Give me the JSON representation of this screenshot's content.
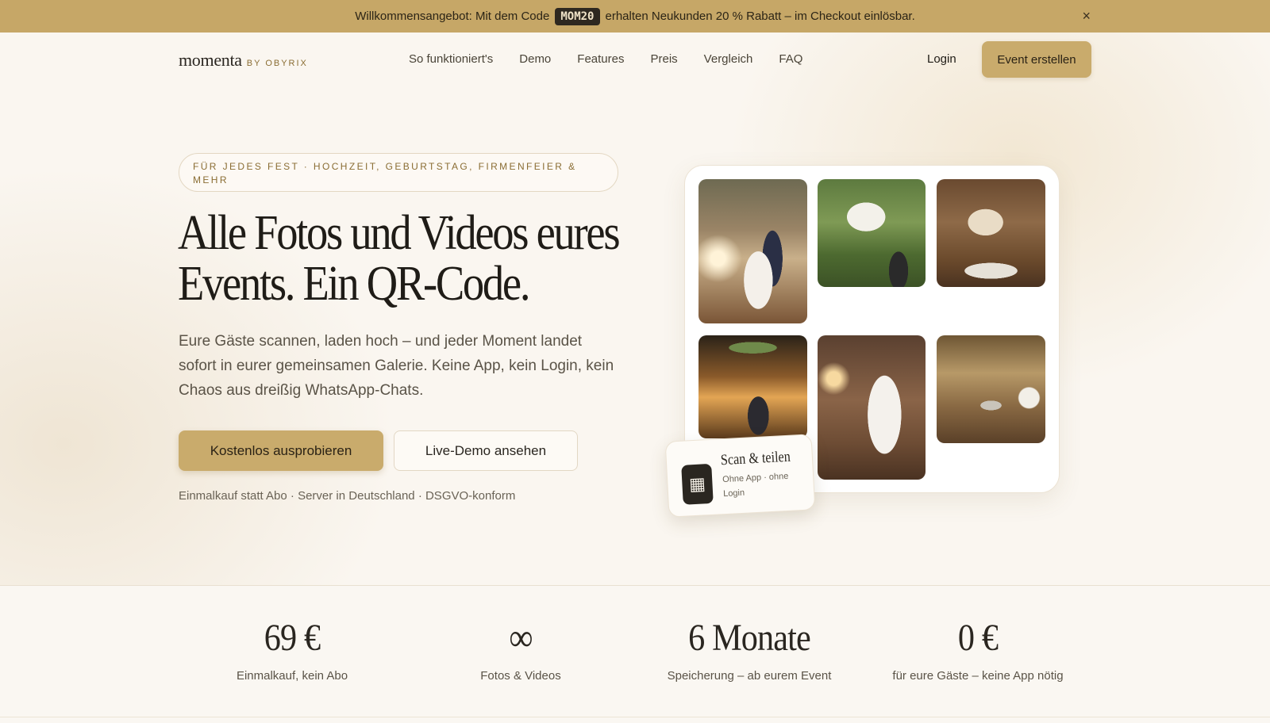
{
  "promo": {
    "text_before": "Willkommensangebot: Mit dem Code",
    "code": "MOM20",
    "text_after": "erhalten Neukunden 20 % Rabatt – im Checkout einlösbar.",
    "close": "×"
  },
  "header": {
    "logo": "momenta",
    "logo_by": "BY OBYRIX",
    "nav": [
      "So funktioniert's",
      "Demo",
      "Features",
      "Preis",
      "Vergleich",
      "FAQ"
    ],
    "login": "Login",
    "cta": "Event erstellen"
  },
  "hero": {
    "eyebrow": "FÜR JEDES FEST · HOCHZEIT, GEBURTSTAG, FIRMENFEIER & MEHR",
    "title_line1": "Alle Fotos und Videos eures",
    "title_line2": "Events. Ein QR-Code.",
    "lead": "Eure Gäste scannen, laden hoch – und jeder Moment landet sofort in eurer gemeinsamen Galerie. Keine App, kein Login, kein Chaos aus dreißig WhatsApp-Chats.",
    "primary_cta": "Kostenlos ausprobieren",
    "secondary_cta": "Live-Demo ansehen",
    "trust": "Einmalkauf statt Abo · Server in Deutschland · DSGVO-konform"
  },
  "scan_card": {
    "title": "Scan & teilen",
    "subtitle": "Ohne App · ohne Login",
    "icon": "qr-code-icon"
  },
  "stats": [
    {
      "value": "69 €",
      "label": "Einmalkauf, kein Abo"
    },
    {
      "value": "∞",
      "label": "Fotos & Videos"
    },
    {
      "value": "6 Monate",
      "label": "Speicherung – ab eurem Event"
    },
    {
      "value": "0 €",
      "label": "für eure Gäste – keine App nötig"
    }
  ],
  "colors": {
    "accent": "#c9ab6c",
    "promo_bg": "#c6a767",
    "background": "#faf6f0",
    "text": "#2a2620"
  }
}
